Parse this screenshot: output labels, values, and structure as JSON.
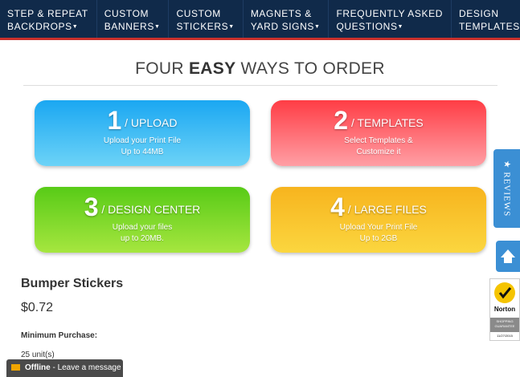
{
  "nav": {
    "items": [
      {
        "line1": "STEP & REPEAT",
        "line2": "BACKDROPS"
      },
      {
        "line1": "CUSTOM",
        "line2": "BANNERS"
      },
      {
        "line1": "CUSTOM",
        "line2": "STICKERS"
      },
      {
        "line1": "MAGNETS &",
        "line2": "YARD SIGNS"
      },
      {
        "line1": "FREQUENTLY ASKED",
        "line2": "QUESTIONS"
      },
      {
        "line1": "DESIGN",
        "line2": "TEMPLATES"
      }
    ],
    "caret": "▼"
  },
  "heading": {
    "pre": "FOUR ",
    "bold": "EASY",
    "post": " WAYS TO ORDER"
  },
  "cards": [
    {
      "num": "1",
      "label": " / UPLOAD",
      "sub1": "Upload your Print File",
      "sub2": "Up to 44MB"
    },
    {
      "num": "2",
      "label": " / TEMPLATES",
      "sub1": "Select Templates &",
      "sub2": "Customize it"
    },
    {
      "num": "3",
      "label": " / DESIGN CENTER",
      "sub1": "Upload your files",
      "sub2": "up to 20MB."
    },
    {
      "num": "4",
      "label": " / LARGE FILES",
      "sub1": "Upload Your Print File",
      "sub2": "Up to 2GB"
    }
  ],
  "product": {
    "title": "Bumper Stickers",
    "price": "$0.72",
    "min_label": "Minimum Purchase:",
    "min_value": "25 unit(s)"
  },
  "side": {
    "reviews": "★ REVIEWS",
    "norton_word": "Norton",
    "norton_band": "SHOPPING GUARANTEE",
    "norton_date": "11/27/2015"
  },
  "chat": {
    "status": "Offline",
    "sep": " - ",
    "message": "Leave a message"
  },
  "colors": {
    "nav_bg": "#102a4a",
    "accent_red": "#c9302c",
    "blue": "#3b8fd4"
  }
}
